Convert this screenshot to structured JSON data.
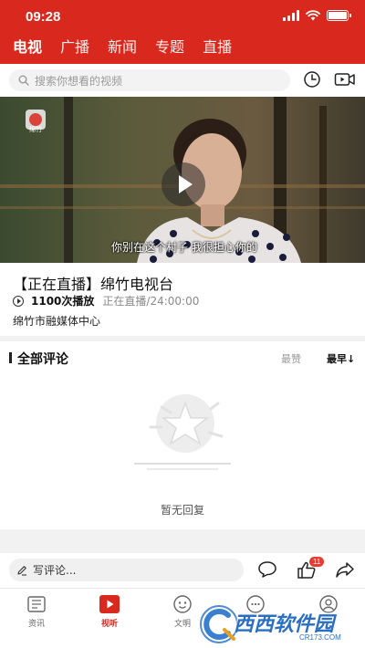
{
  "status": {
    "time": "09:28"
  },
  "nav": {
    "tabs": [
      "电视",
      "广播",
      "新闻",
      "专题",
      "直播"
    ],
    "active_index": 0
  },
  "search": {
    "placeholder": "搜索你想看的视频"
  },
  "video": {
    "channel_logo_text": "绵竹",
    "subtitle": "你别在这个村子 我很担心你的"
  },
  "program": {
    "title": "【正在直播】绵竹电视台",
    "play_count": "1100次播放",
    "live_time": "正在直播/24:00:00",
    "organization": "绵竹市融媒体中心"
  },
  "comments": {
    "heading": "全部评论",
    "sort_hot": "最赞",
    "sort_new": "最早",
    "empty_text": "暂无回复"
  },
  "comment_bar": {
    "placeholder": "写评论...",
    "like_badge": "11"
  },
  "tabbar": {
    "items": [
      {
        "label": "资讯",
        "icon": "news-icon"
      },
      {
        "label": "视听",
        "icon": "play-tv-icon",
        "active": true
      },
      {
        "label": "文明",
        "icon": "civilization-icon"
      },
      {
        "label": "",
        "icon": "chat-icon"
      },
      {
        "label": "",
        "icon": "profile-icon"
      }
    ]
  },
  "watermark": {
    "text": "西西软件园",
    "domain": "CR173.COM"
  },
  "colors": {
    "brand_red": "#d9281d",
    "badge_red": "#e73a32"
  }
}
